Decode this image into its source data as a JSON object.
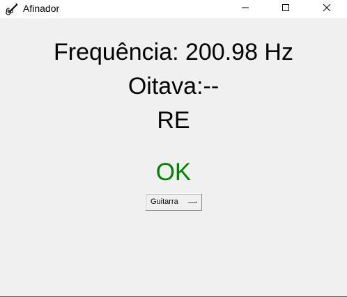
{
  "window": {
    "title": "Afinador",
    "icon": "guitar-icon"
  },
  "controls": {
    "minimize_icon": "minimize-icon",
    "maximize_icon": "maximize-icon",
    "close_icon": "close-icon"
  },
  "tuner": {
    "frequency_text": "Frequência: 200.98 Hz",
    "octave_text": "Oitava:--",
    "note_text": "RE",
    "status_text": "OK",
    "instrument_selected": "Guitarra"
  },
  "colors": {
    "background": "#f0f0f0",
    "titlebar": "#ffffff",
    "status_ok": "#008000",
    "text": "#000000"
  }
}
